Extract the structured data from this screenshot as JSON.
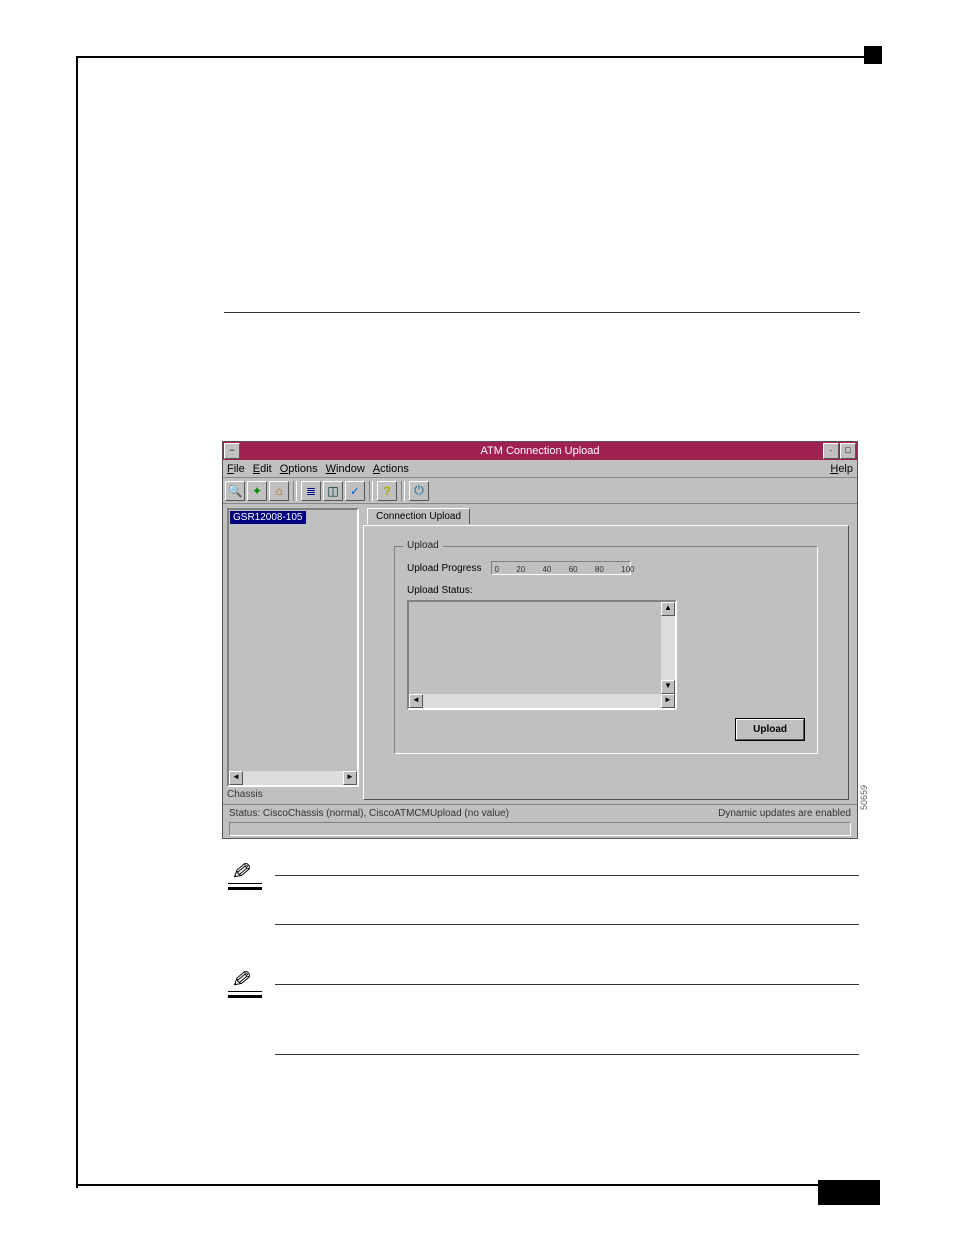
{
  "window": {
    "title": "ATM Connection Upload",
    "sys_left": "−",
    "sys_min": "·",
    "sys_max": "□"
  },
  "menubar": {
    "file": "File",
    "edit": "Edit",
    "options": "Options",
    "window": "Window",
    "actions": "Actions",
    "help": "Help"
  },
  "toolbar": {
    "binoculars": "🔍",
    "topology": "✦",
    "home": "⌂",
    "rows": "≣",
    "can": "◫",
    "check": "✓",
    "help": "?",
    "power": "⏻"
  },
  "left_pane": {
    "selected_item": "GSR12008-105",
    "label": "Chassis"
  },
  "tab": {
    "label": "Connection Upload"
  },
  "upload_group": {
    "legend": "Upload",
    "progress_label": "Upload Progress",
    "ticks": [
      "0",
      "20",
      "40",
      "60",
      "80",
      "100"
    ],
    "status_label": "Upload Status:",
    "button_label": "Upload"
  },
  "statusbar": {
    "left": "Status: CiscoChassis (normal), CiscoATMCMUpload (no value)",
    "right": "Dynamic updates are enabled"
  },
  "figure_code": "50659"
}
